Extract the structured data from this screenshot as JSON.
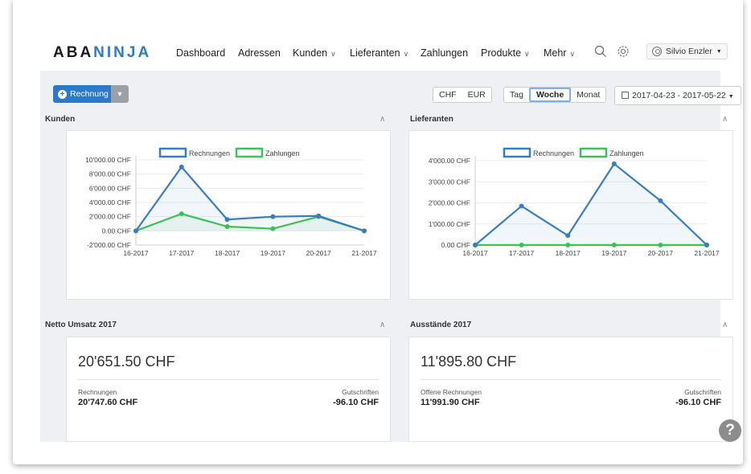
{
  "nav": {
    "logo_a": "ABA",
    "logo_b": "NINJA",
    "items": [
      {
        "label": "Dashboard"
      },
      {
        "label": "Adressen"
      },
      {
        "label": "Kunden"
      },
      {
        "label": "Lieferanten"
      },
      {
        "label": "Zahlungen"
      },
      {
        "label": "Produkte"
      },
      {
        "label": "Mehr"
      }
    ],
    "user": "Silvio Enzler"
  },
  "toolbar": {
    "new_label": "Rechnung",
    "currencies": [
      "CHF",
      "EUR"
    ],
    "periods": [
      "Tag",
      "Woche",
      "Monat"
    ],
    "active_period": "Woche",
    "date_range": "2017-04-23 - 2017-05-22"
  },
  "chart_data": [
    {
      "type": "line",
      "title": "Kunden",
      "categories": [
        "16-2017",
        "17-2017",
        "18-2017",
        "19-2017",
        "20-2017",
        "21-2017"
      ],
      "y_ticks": [
        "10'000.00 CHF",
        "8'000.00 CHF",
        "6'000.00 CHF",
        "4'000.00 CHF",
        "2'000.00 CHF",
        "0.00 CHF",
        "-2'000.00 CHF"
      ],
      "ylim": [
        -2000,
        10000
      ],
      "legend": "top-center",
      "series": [
        {
          "name": "Rechnungen",
          "color": "#3a7dbf",
          "values": [
            0,
            9000,
            1600,
            2000,
            2100,
            0
          ]
        },
        {
          "name": "Zahlungen",
          "color": "#3fbf5a",
          "values": [
            0,
            2400,
            600,
            300,
            2000,
            0
          ]
        }
      ]
    },
    {
      "type": "line",
      "title": "Lieferanten",
      "categories": [
        "16-2017",
        "17-2017",
        "18-2017",
        "19-2017",
        "20-2017",
        "21-2017"
      ],
      "y_ticks": [
        "4'000.00 CHF",
        "3'000.00 CHF",
        "2'000.00 CHF",
        "1'000.00 CHF",
        "0.00 CHF"
      ],
      "ylim": [
        0,
        4000
      ],
      "legend": "top-center",
      "series": [
        {
          "name": "Rechnungen",
          "color": "#3a7dbf",
          "values": [
            0,
            1850,
            450,
            3850,
            2100,
            0
          ]
        },
        {
          "name": "Zahlungen",
          "color": "#3fbf5a",
          "values": [
            0,
            0,
            0,
            0,
            0,
            0
          ]
        }
      ]
    }
  ],
  "netto": {
    "title": "Netto Umsatz 2017",
    "value": "20'651.50 CHF",
    "left_label": "Rechnungen",
    "left_value": "20'747.60 CHF",
    "right_label": "Gutschriften",
    "right_value": "-96.10 CHF"
  },
  "ausstaende": {
    "title": "Ausstände 2017",
    "value": "11'895.80 CHF",
    "left_label": "Offene Rechnungen",
    "left_value": "11'991.90 CHF",
    "right_label": "Gutschriften",
    "right_value": "-96.10 CHF"
  },
  "help": "?"
}
